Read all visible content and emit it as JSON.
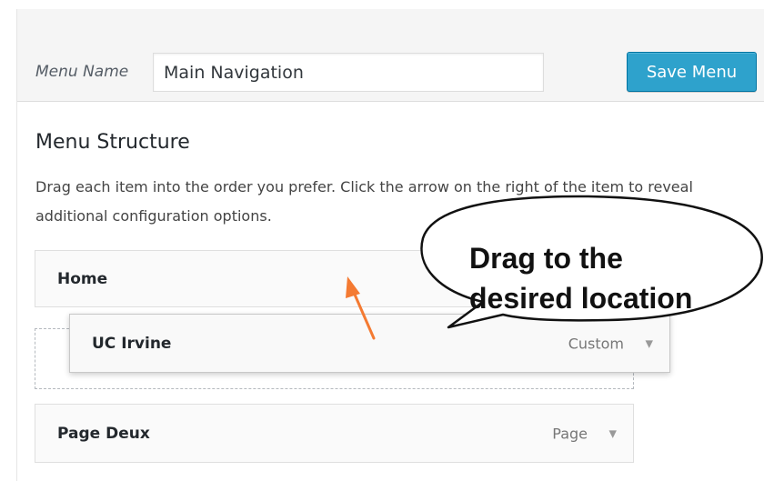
{
  "header": {
    "menu_name_label": "Menu Name",
    "menu_name_value": "Main Navigation",
    "save_label": "Save Menu"
  },
  "structure": {
    "title": "Menu Structure",
    "description": "Drag each item into the order you prefer. Click the arrow on the right of the item to reveal additional configuration options."
  },
  "menu_items": [
    {
      "title": "Home",
      "type": "",
      "state": "static"
    },
    {
      "title": "UC Irvine",
      "type": "Custom",
      "state": "dragging"
    },
    {
      "title": "Page Deux",
      "type": "Page",
      "state": "static"
    }
  ],
  "annotation": {
    "line1": "Drag to the",
    "line2": "desired location",
    "arrow_color": "#f47a32"
  },
  "icons": {
    "item_toggle": "chevron-down-icon"
  },
  "colors": {
    "primary_button": "#2ea2cc",
    "header_background": "#f5f5f5"
  }
}
